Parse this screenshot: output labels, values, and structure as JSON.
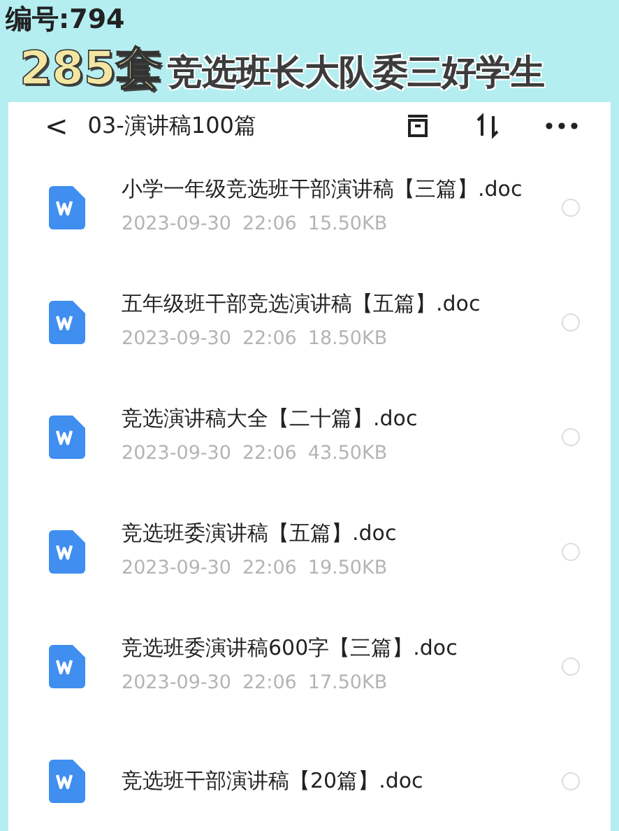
{
  "serial": "编号:794",
  "banner": {
    "count": "285套",
    "subtitle": "竞选班长大队委三好学生"
  },
  "header": {
    "back": "<",
    "title": "03-演讲稿100篇"
  },
  "files": [
    {
      "name": "小学一年级竞选班干部演讲稿【三篇】.doc",
      "date": "2023-09-30",
      "time": "22:06",
      "size": "15.50KB",
      "selected": false
    },
    {
      "name": "五年级班干部竞选演讲稿【五篇】.doc",
      "date": "2023-09-30",
      "time": "22:06",
      "size": "18.50KB",
      "selected": false
    },
    {
      "name": "竞选演讲稿大全【二十篇】.doc",
      "date": "2023-09-30",
      "time": "22:06",
      "size": "43.50KB",
      "selected": false
    },
    {
      "name": "竞选班委演讲稿【五篇】.doc",
      "date": "2023-09-30",
      "time": "22:06",
      "size": "19.50KB",
      "selected": false
    },
    {
      "name": "竞选班委演讲稿600字【三篇】.doc",
      "date": "2023-09-30",
      "time": "22:06",
      "size": "17.50KB",
      "selected": false
    },
    {
      "name": "竞选班干部演讲稿【20篇】.doc",
      "selected": false
    }
  ]
}
